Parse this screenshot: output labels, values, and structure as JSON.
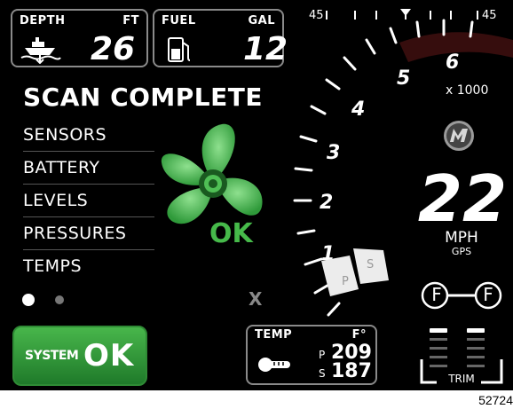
{
  "depth": {
    "label": "DEPTH",
    "unit": "FT",
    "value": "26"
  },
  "fuel": {
    "label": "FUEL",
    "unit": "GAL",
    "value": "12"
  },
  "steering": {
    "left_label": "45",
    "right_label": "45"
  },
  "scan": {
    "title": "SCAN COMPLETE",
    "items": [
      "SENSORS",
      "BATTERY",
      "LEVELS",
      "PRESSURES",
      "TEMPS"
    ],
    "page_dots": {
      "active": 1,
      "total": 2
    }
  },
  "propeller": {
    "status": "OK",
    "color": "#46b94a"
  },
  "tach": {
    "marks": [
      "1",
      "2",
      "3",
      "4",
      "5",
      "6"
    ],
    "multiplier": "x 1000"
  },
  "trim_tabs": {
    "port": "P",
    "starboard": "S"
  },
  "close_label": "X",
  "speed": {
    "value": "22",
    "unit": "MPH",
    "source": "GPS"
  },
  "gear": {
    "left": "F",
    "right": "F"
  },
  "trim": {
    "label": "TRIM"
  },
  "system_status": {
    "label": "SYSTEM",
    "value": "OK",
    "color": "#2f9a3a"
  },
  "temp": {
    "label": "TEMP",
    "unit": "F°",
    "port_label": "P",
    "port_value": "209",
    "stbd_label": "S",
    "stbd_value": "187"
  },
  "figure_id": "52724"
}
